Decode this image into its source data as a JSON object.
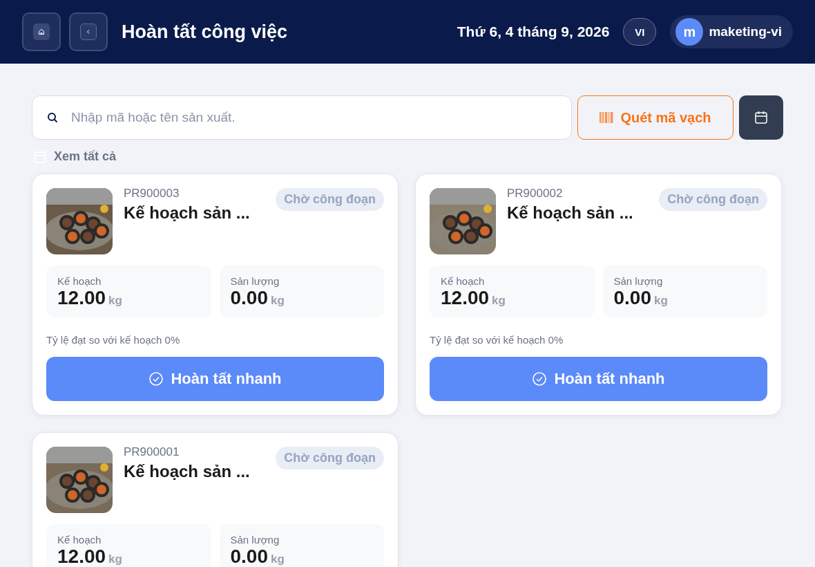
{
  "header": {
    "title": "Hoàn tất công việc",
    "date": "Thứ 6, 4 tháng 9, 2026",
    "language": "VI",
    "user": {
      "initial": "m",
      "name": "maketing-vi"
    }
  },
  "search": {
    "placeholder": "Nhập mã hoặc tên sản xuất."
  },
  "scan_button": "Quét mã vạch",
  "filter_label": "Xem tất cả",
  "orders": [
    {
      "code": "PR900003",
      "title": "Kế hoạch sản ...",
      "status": "Chờ công đoạn",
      "plan_label": "Kế hoạch",
      "plan_value": "12.00",
      "plan_unit": "kg",
      "output_label": "Sản lượng",
      "output_value": "0.00",
      "output_unit": "kg",
      "rate": "Tỷ lệ đạt so với kế hoạch 0%",
      "action": "Hoàn tất nhanh"
    },
    {
      "code": "PR900002",
      "title": "Kế hoạch sản ...",
      "status": "Chờ công đoạn",
      "plan_label": "Kế hoạch",
      "plan_value": "12.00",
      "plan_unit": "kg",
      "output_label": "Sản lượng",
      "output_value": "0.00",
      "output_unit": "kg",
      "rate": "Tỷ lệ đạt so với kế hoạch 0%",
      "action": "Hoàn tất nhanh"
    },
    {
      "code": "PR900001",
      "title": "Kế hoạch sản ...",
      "status": "Chờ công đoạn",
      "plan_label": "Kế hoạch",
      "plan_value": "12.00",
      "plan_unit": "kg",
      "output_label": "Sản lượng",
      "output_value": "0.00",
      "output_unit": "kg"
    }
  ]
}
